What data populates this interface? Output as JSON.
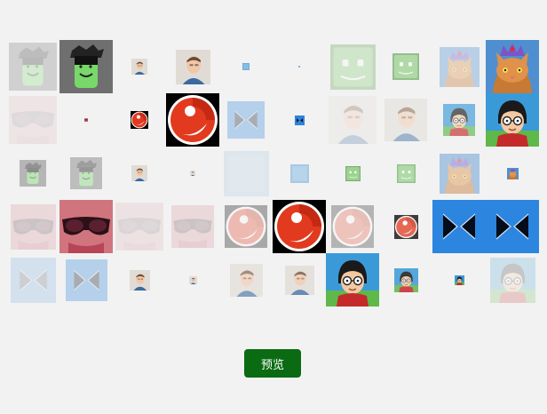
{
  "preview_label": "预览",
  "colors": {
    "background": "#f2f2f2",
    "button": "#0a6b12",
    "button_text": "#ffffff"
  },
  "thumbnails": [
    {
      "name": "android-avatar",
      "icon": "android",
      "opacity": 0.25,
      "scale": 0.9
    },
    {
      "name": "android-avatar",
      "icon": "android",
      "opacity": 1,
      "scale": 1
    },
    {
      "name": "man-portrait",
      "icon": "man",
      "opacity": 1,
      "scale": 0.3
    },
    {
      "name": "man-portrait",
      "icon": "man",
      "opacity": 1,
      "scale": 0.65
    },
    {
      "name": "blue-square",
      "icon": "blue-tile",
      "opacity": 1,
      "scale": 0.13
    },
    {
      "name": "blue-square",
      "icon": "blue-tile",
      "opacity": 1,
      "scale": 0.04
    },
    {
      "name": "green-smiley-avatar",
      "icon": "green-face",
      "opacity": 0.25,
      "scale": 0.85
    },
    {
      "name": "green-smiley-avatar",
      "icon": "green-face",
      "opacity": 0.5,
      "scale": 0.5
    },
    {
      "name": "cat-crown",
      "icon": "cat",
      "opacity": 0.35,
      "scale": 0.75
    },
    {
      "name": "cat-crown",
      "icon": "cat",
      "opacity": 1,
      "scale": 1
    },
    {
      "name": "sunglasses-photo",
      "icon": "sunglasses",
      "opacity": 0.1,
      "scale": 0.9
    },
    {
      "name": "sunglasses-photo",
      "icon": "sunglasses",
      "opacity": 1,
      "scale": 0.07
    },
    {
      "name": "red-logo",
      "icon": "red-logo",
      "opacity": 1,
      "scale": 0.33
    },
    {
      "name": "red-logo",
      "icon": "red-logo",
      "opacity": 1,
      "scale": 1
    },
    {
      "name": "bowtie-logo",
      "icon": "bowtie",
      "opacity": 0.3,
      "scale": 0.7
    },
    {
      "name": "bowtie-logo",
      "icon": "bowtie",
      "opacity": 1,
      "scale": 0.18
    },
    {
      "name": "man-portrait",
      "icon": "man",
      "opacity": 0.25,
      "scale": 0.9
    },
    {
      "name": "man-portrait",
      "icon": "man",
      "opacity": 0.45,
      "scale": 0.8
    },
    {
      "name": "cartoon-avatar",
      "icon": "cartoon",
      "opacity": 0.65,
      "scale": 0.6
    },
    {
      "name": "cartoon-avatar",
      "icon": "cartoon",
      "opacity": 1,
      "scale": 1
    },
    {
      "name": "android-avatar",
      "icon": "android",
      "opacity": 0.45,
      "scale": 0.5
    },
    {
      "name": "android-avatar",
      "icon": "android",
      "opacity": 0.4,
      "scale": 0.6
    },
    {
      "name": "man-portrait",
      "icon": "man",
      "opacity": 1,
      "scale": 0.3
    },
    {
      "name": "man-portrait",
      "icon": "man",
      "opacity": 1,
      "scale": 0.1
    },
    {
      "name": "blue-square",
      "icon": "blue-tile",
      "opacity": 0.15,
      "scale": 0.85
    },
    {
      "name": "blue-square",
      "icon": "blue-tile",
      "opacity": 0.55,
      "scale": 0.35
    },
    {
      "name": "green-smiley-avatar",
      "icon": "green-face",
      "opacity": 0.65,
      "scale": 0.28
    },
    {
      "name": "green-smiley-avatar",
      "icon": "green-face",
      "opacity": 0.5,
      "scale": 0.35
    },
    {
      "name": "cat-crown",
      "icon": "cat",
      "opacity": 0.45,
      "scale": 0.75
    },
    {
      "name": "cat-crown",
      "icon": "cat",
      "opacity": 1,
      "scale": 0.22
    },
    {
      "name": "sunglasses-photo",
      "icon": "sunglasses",
      "opacity": 0.2,
      "scale": 0.85
    },
    {
      "name": "sunglasses-photo",
      "icon": "sunglasses",
      "opacity": 1,
      "scale": 1
    },
    {
      "name": "sunglasses-photo",
      "icon": "sunglasses",
      "opacity": 0.12,
      "scale": 0.9
    },
    {
      "name": "sunglasses-photo",
      "icon": "sunglasses",
      "opacity": 0.2,
      "scale": 0.8
    },
    {
      "name": "red-logo",
      "icon": "red-logo",
      "opacity": 0.3,
      "scale": 0.8
    },
    {
      "name": "red-logo",
      "icon": "red-logo",
      "opacity": 1,
      "scale": 1
    },
    {
      "name": "red-logo",
      "icon": "red-logo",
      "opacity": 0.25,
      "scale": 0.8
    },
    {
      "name": "red-logo",
      "icon": "red-logo",
      "opacity": 0.75,
      "scale": 0.45
    },
    {
      "name": "bowtie-logo",
      "icon": "bowtie",
      "opacity": 1,
      "scale": 1
    },
    {
      "name": "bowtie-logo",
      "icon": "bowtie",
      "opacity": 1,
      "scale": 1
    },
    {
      "name": "bowtie-logo",
      "icon": "bowtie",
      "opacity": 0.15,
      "scale": 0.85
    },
    {
      "name": "bowtie-logo",
      "icon": "bowtie",
      "opacity": 0.3,
      "scale": 0.78
    },
    {
      "name": "man-portrait",
      "icon": "man",
      "opacity": 1,
      "scale": 0.38
    },
    {
      "name": "man-portrait",
      "icon": "man",
      "opacity": 1,
      "scale": 0.15
    },
    {
      "name": "man-portrait",
      "icon": "man",
      "opacity": 0.6,
      "scale": 0.62
    },
    {
      "name": "man-portrait",
      "icon": "man",
      "opacity": 0.75,
      "scale": 0.55
    },
    {
      "name": "cartoon-avatar",
      "icon": "cartoon",
      "opacity": 1,
      "scale": 1
    },
    {
      "name": "cartoon-avatar",
      "icon": "cartoon",
      "opacity": 0.85,
      "scale": 0.45
    },
    {
      "name": "cartoon-avatar",
      "icon": "cartoon",
      "opacity": 1,
      "scale": 0.18
    },
    {
      "name": "cartoon-avatar",
      "icon": "cartoon",
      "opacity": 0.2,
      "scale": 0.85
    }
  ]
}
